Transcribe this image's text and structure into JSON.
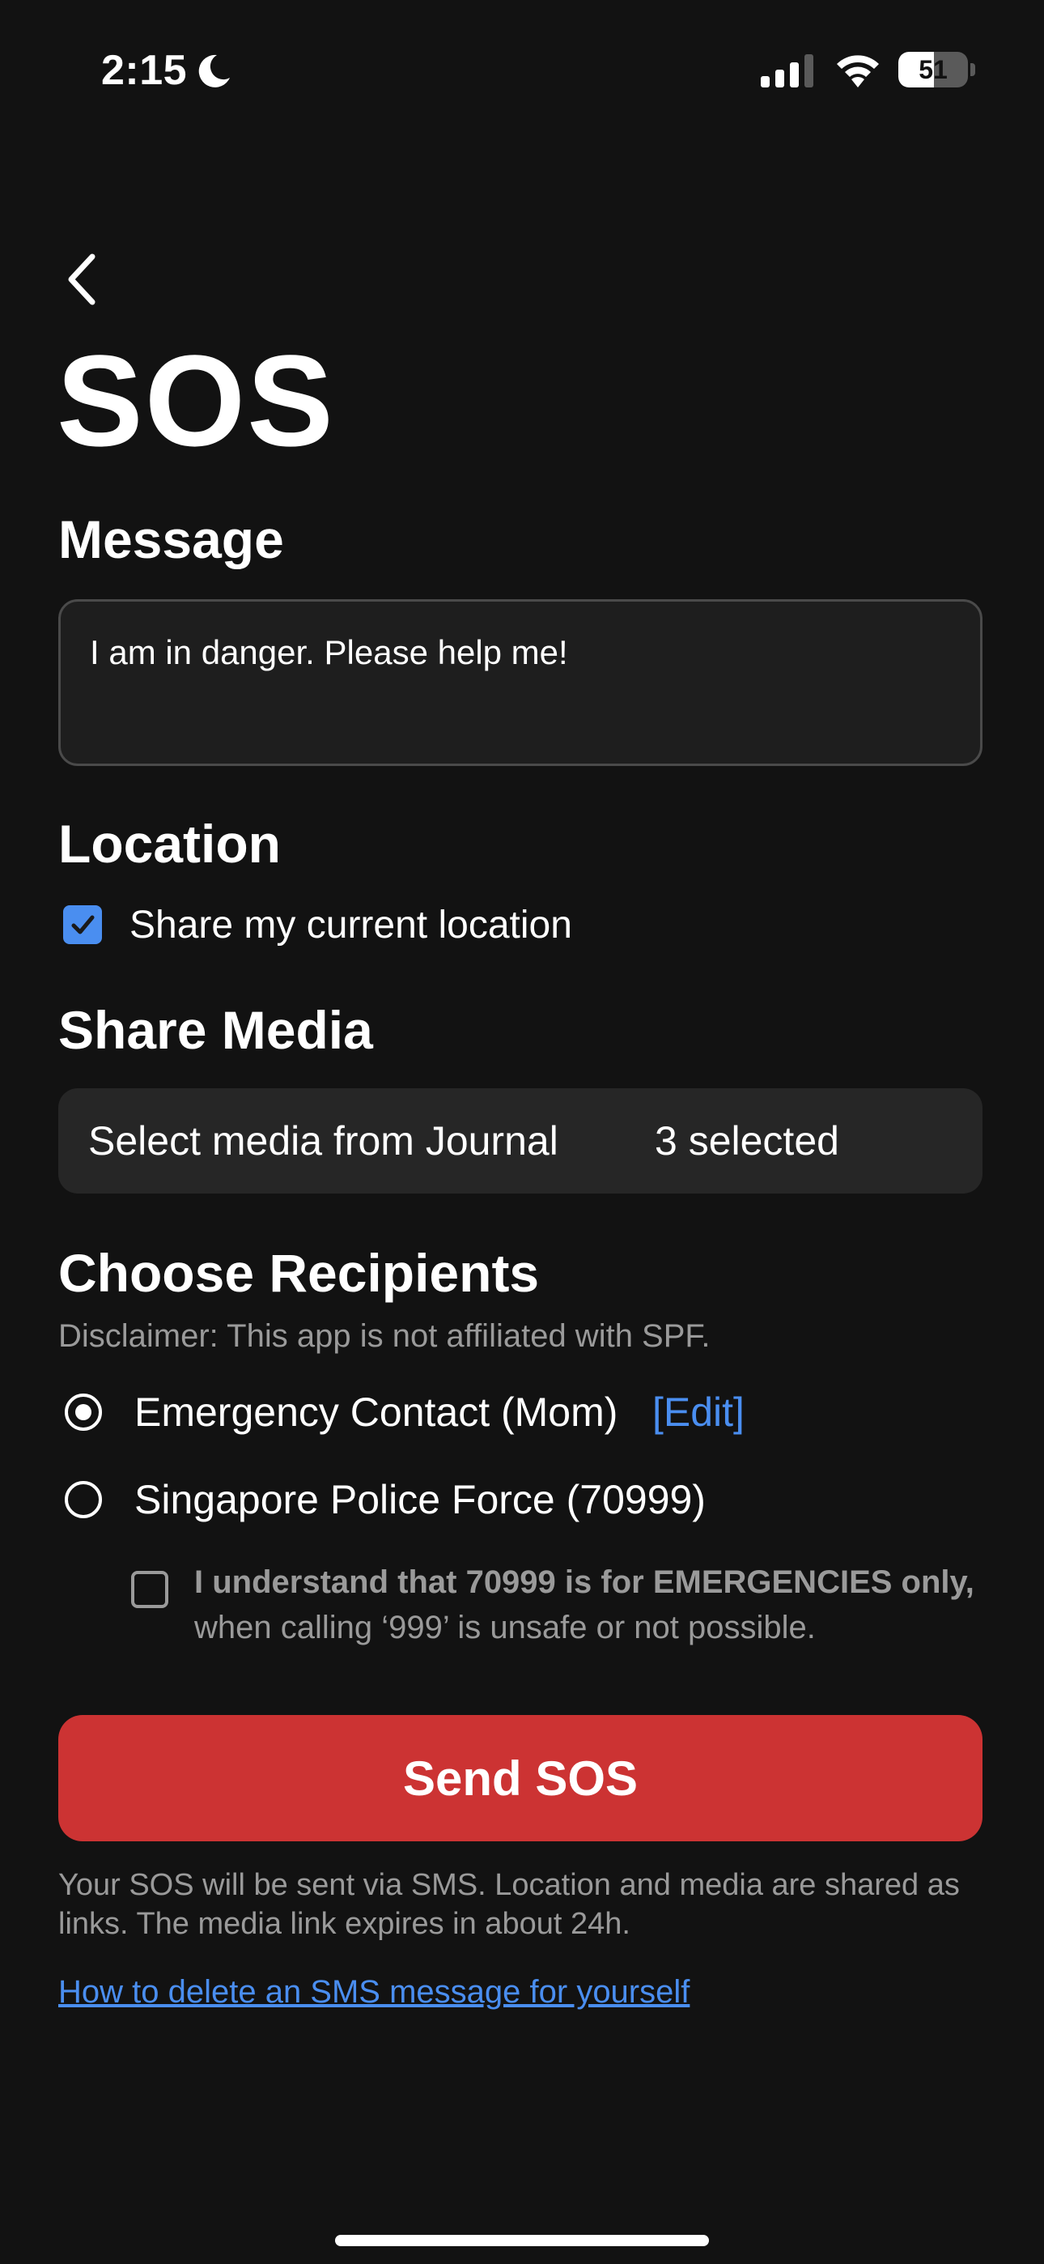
{
  "status_bar": {
    "time": "2:15",
    "battery_level": "51",
    "battery_percent": 0.51
  },
  "header": {
    "back_icon": "chevron-left-icon",
    "title": "SOS"
  },
  "message": {
    "heading": "Message",
    "value": "I am in danger. Please help me!"
  },
  "location": {
    "heading": "Location",
    "checkbox_label": "Share my current location",
    "checked": true
  },
  "media": {
    "heading": "Share Media",
    "select_label": "Select media from Journal",
    "selected_count": "3 selected"
  },
  "recipients": {
    "heading": "Choose Recipients",
    "disclaimer": "Disclaimer: This app is not affiliated with SPF.",
    "options": [
      {
        "label": "Emergency Contact (Mom)",
        "selected": true
      },
      {
        "label": "Singapore Police Force (70999)",
        "selected": false
      }
    ],
    "edit_label": "[Edit]",
    "ack_bold": "I understand that 70999 is for EMERGENCIES only,",
    "ack_rest": " when calling ‘999’ is unsafe or not possible."
  },
  "actions": {
    "send_label": "Send SOS"
  },
  "footer": {
    "note": "Your SOS will be sent via SMS. Location and media are shared as links. The media link expires in about 24h.",
    "help_link": "How to delete an SMS message for yourself"
  },
  "colors": {
    "background": "#121212",
    "accent_blue": "#4a8ef0",
    "danger_red": "#cc3333",
    "muted_text": "#9a9a9a"
  }
}
